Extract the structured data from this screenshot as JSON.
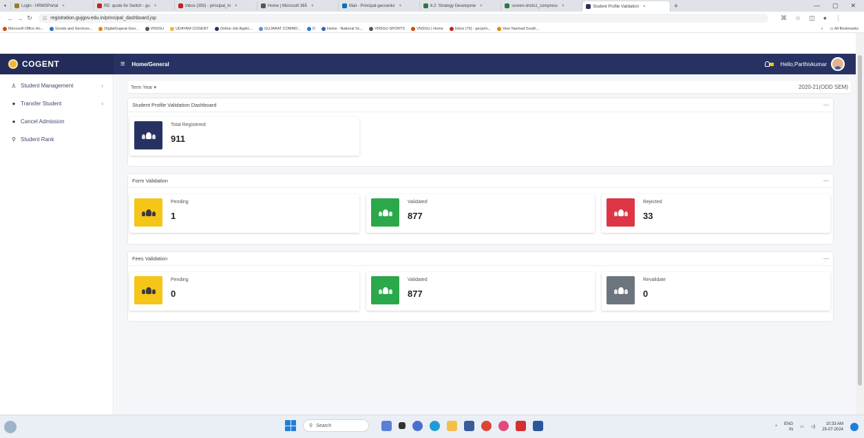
{
  "browser": {
    "tabs": [
      {
        "label": "Login - HRMSPortal",
        "color": "#9b7b2e"
      },
      {
        "label": "RE: quote for Switch - gu",
        "color": "#c5221f"
      },
      {
        "label": "Inbox (393) - principal_ln",
        "color": "#c5221f"
      },
      {
        "label": "Home | Microsoft 365",
        "color": "#555555"
      },
      {
        "label": "Mail - Principal-gecvankc",
        "color": "#0f6cbd"
      },
      {
        "label": "6.2: Strategy Developme",
        "color": "#2b7a3f"
      },
      {
        "label": "screen-shots1_compress",
        "color": "#2b7a3f"
      },
      {
        "label": "Student Profile Validation",
        "color": "#283262"
      }
    ],
    "url": "registration.gujgov.edu.in/principal_dashboard.jsp",
    "bookmarks": [
      "Microsoft Office Ho...",
      "Goods and Services...",
      "DigitalGujarat-Gen...",
      "VNSGU",
      "UDAYAM COGENT",
      "Online Job Applic...",
      "GUJARAT COMMO...",
      "D",
      "Home - National Sc...",
      "VNSGU-SPORTS",
      "VNSGU | Home",
      "Inbox (70) - gecprin...",
      "Veer Narmad South..."
    ],
    "all_bookmarks": "All Bookmarks"
  },
  "app": {
    "brand": "COGENT",
    "breadcrumb": "Home/General",
    "greeting": "Hello,Parthivkumar",
    "colors": {
      "navbar": "#283262",
      "yellow": "#f5c518",
      "green": "#2aa84a",
      "red": "#dc3545",
      "gray": "#6c757d",
      "navy": "#283262"
    }
  },
  "sidebar": {
    "items": [
      {
        "label": "Student Management",
        "icon": "user-icon",
        "has_chevron": true
      },
      {
        "label": "Transfer Student",
        "icon": "dot-icon",
        "has_chevron": true
      },
      {
        "label": "Cancel Admission",
        "icon": "dot-icon",
        "has_chevron": false
      },
      {
        "label": "Student Rank",
        "icon": "search-icon",
        "has_chevron": false
      }
    ]
  },
  "term": {
    "label": "Term Year ▾",
    "value": "2020-21(ODD SEM)"
  },
  "sections": {
    "dashboard": {
      "title": "Student Profile Validation Dashboard",
      "boxes": [
        {
          "label": "Total Registered",
          "value": "911"
        }
      ]
    },
    "form": {
      "title": "Form Validation",
      "boxes": [
        {
          "label": "Pending",
          "value": "1"
        },
        {
          "label": "Validated",
          "value": "877"
        },
        {
          "label": "Rejected",
          "value": "33"
        }
      ]
    },
    "fees": {
      "title": "Fees Validation",
      "boxes": [
        {
          "label": "Pending",
          "value": "0"
        },
        {
          "label": "Validated",
          "value": "877"
        },
        {
          "label": "Revalidate",
          "value": "0"
        }
      ]
    }
  },
  "taskbar": {
    "search": "Search",
    "lang": "ENG",
    "region": "IN",
    "time": "10:33 AM",
    "date": "25-07-2024"
  }
}
